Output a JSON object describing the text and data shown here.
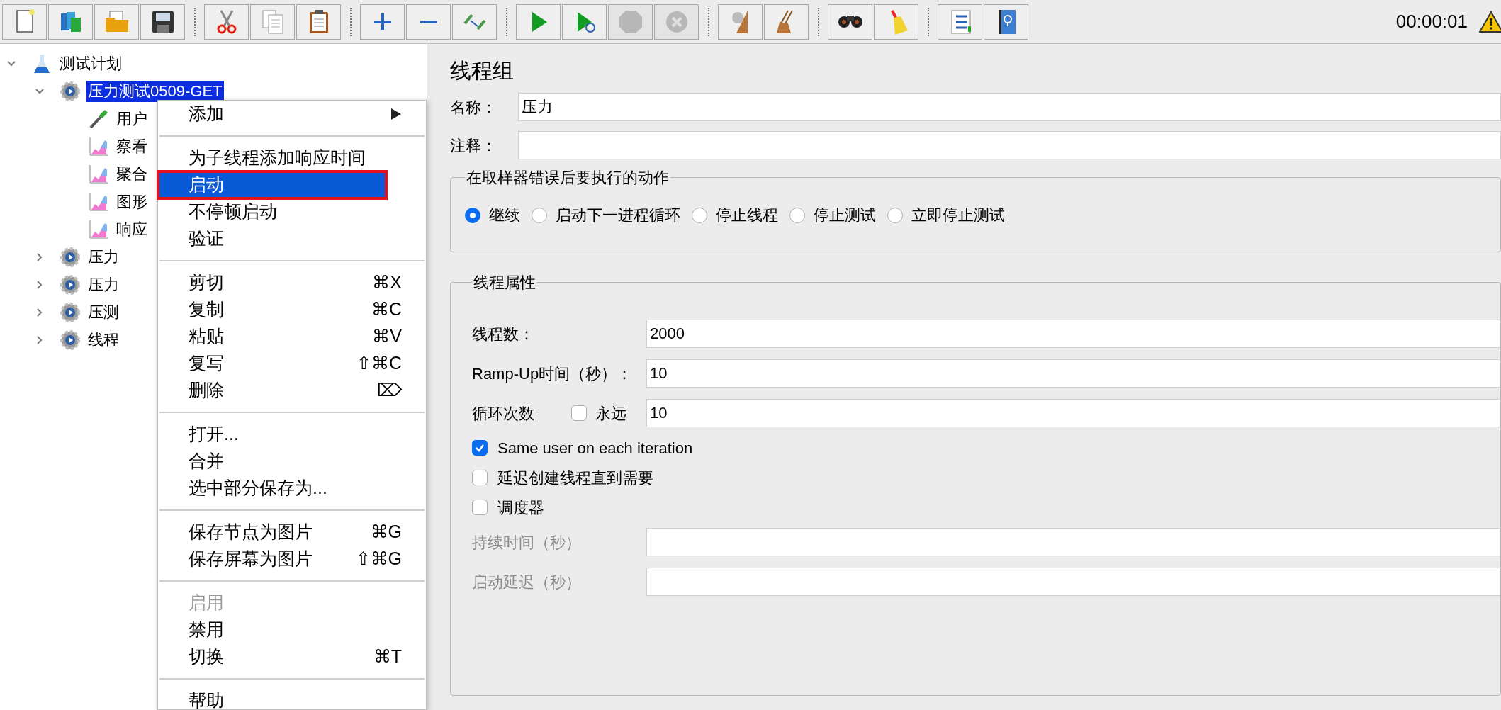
{
  "toolbar": {
    "groups": [
      [
        {
          "kind": "new",
          "disabled": false
        },
        {
          "kind": "templates",
          "disabled": false
        },
        {
          "kind": "open",
          "disabled": false
        },
        {
          "kind": "save",
          "disabled": false
        }
      ],
      [
        {
          "kind": "cut",
          "disabled": false
        },
        {
          "kind": "copy",
          "disabled": false
        },
        {
          "kind": "paste",
          "disabled": false
        }
      ],
      [
        {
          "kind": "expand",
          "disabled": false
        },
        {
          "kind": "collapse",
          "disabled": false
        },
        {
          "kind": "toggle",
          "disabled": false
        }
      ],
      [
        {
          "kind": "start",
          "disabled": false
        },
        {
          "kind": "start-no-pause",
          "disabled": false
        },
        {
          "kind": "stop",
          "disabled": true
        },
        {
          "kind": "shutdown",
          "disabled": true
        }
      ],
      [
        {
          "kind": "clear",
          "disabled": false
        },
        {
          "kind": "clear-all",
          "disabled": false
        }
      ],
      [
        {
          "kind": "search",
          "disabled": false
        },
        {
          "kind": "reset-search",
          "disabled": false
        }
      ],
      [
        {
          "kind": "function-helper",
          "disabled": false
        },
        {
          "kind": "help",
          "disabled": false
        }
      ]
    ],
    "timer": "00:00:01"
  },
  "tree": [
    {
      "label": "测试计划",
      "kind": "plan",
      "expanded": true,
      "selected": false,
      "children": [
        {
          "label": "压力测试0509-GET",
          "kind": "thread-group",
          "expanded": true,
          "selected": true,
          "children": [
            {
              "label": "用户",
              "kind": "sampler",
              "selected": false
            },
            {
              "label": "察看",
              "kind": "listener",
              "selected": false
            },
            {
              "label": "聚合",
              "kind": "listener",
              "selected": false
            },
            {
              "label": "图形",
              "kind": "listener",
              "selected": false
            },
            {
              "label": "响应",
              "kind": "listener",
              "selected": false
            }
          ]
        },
        {
          "label": "压力",
          "kind": "thread-group",
          "expanded": false,
          "selected": false
        },
        {
          "label": "压力",
          "kind": "thread-group",
          "expanded": false,
          "selected": false
        },
        {
          "label": "压测",
          "kind": "thread-group",
          "expanded": false,
          "selected": false
        },
        {
          "label": "线程",
          "kind": "thread-group",
          "expanded": false,
          "selected": false
        }
      ]
    }
  ],
  "context_menu": [
    {
      "kind": "submenu",
      "label": "添加",
      "selected": false,
      "disabled": false
    },
    {
      "kind": "separator"
    },
    {
      "kind": "item",
      "label": "为子线程添加响应时间",
      "selected": false,
      "disabled": false
    },
    {
      "kind": "item",
      "label": "启动",
      "selected": true,
      "disabled": false,
      "outlined": true
    },
    {
      "kind": "item",
      "label": "不停顿启动",
      "selected": false,
      "disabled": false
    },
    {
      "kind": "item",
      "label": "验证",
      "selected": false,
      "disabled": false
    },
    {
      "kind": "separator"
    },
    {
      "kind": "item",
      "label": "剪切",
      "shortcut": "⌘X",
      "selected": false,
      "disabled": false
    },
    {
      "kind": "item",
      "label": "复制",
      "shortcut": "⌘C",
      "selected": false,
      "disabled": false
    },
    {
      "kind": "item",
      "label": "粘贴",
      "shortcut": "⌘V",
      "selected": false,
      "disabled": false
    },
    {
      "kind": "item",
      "label": "复写",
      "shortcut": "⇧⌘C",
      "selected": false,
      "disabled": false
    },
    {
      "kind": "item",
      "label": "删除",
      "shortcut": "⌦",
      "selected": false,
      "disabled": false
    },
    {
      "kind": "separator"
    },
    {
      "kind": "item",
      "label": "打开...",
      "selected": false,
      "disabled": false
    },
    {
      "kind": "item",
      "label": "合并",
      "selected": false,
      "disabled": false
    },
    {
      "kind": "item",
      "label": "选中部分保存为...",
      "selected": false,
      "disabled": false
    },
    {
      "kind": "separator"
    },
    {
      "kind": "item",
      "label": "保存节点为图片",
      "shortcut": "⌘G",
      "selected": false,
      "disabled": false
    },
    {
      "kind": "item",
      "label": "保存屏幕为图片",
      "shortcut": "⇧⌘G",
      "selected": false,
      "disabled": false
    },
    {
      "kind": "separator"
    },
    {
      "kind": "item",
      "label": "启用",
      "selected": false,
      "disabled": true
    },
    {
      "kind": "item",
      "label": "禁用",
      "selected": false,
      "disabled": false
    },
    {
      "kind": "item",
      "label": "切换",
      "shortcut": "⌘T",
      "selected": false,
      "disabled": false
    },
    {
      "kind": "separator"
    },
    {
      "kind": "item",
      "label": "帮助",
      "selected": false,
      "disabled": false
    }
  ],
  "panel": {
    "title": "线程组",
    "name": {
      "label": "名称：",
      "value": "压力"
    },
    "comment": {
      "label": "注释："
    },
    "error_action": {
      "title": "在取样器错误后要执行的动作",
      "options": [
        {
          "label": "继续",
          "selected": true
        },
        {
          "label": "启动下一进程循环",
          "selected": false
        },
        {
          "label": "停止线程",
          "selected": false
        },
        {
          "label": "停止测试",
          "selected": false
        },
        {
          "label": "立即停止测试",
          "selected": false
        }
      ]
    },
    "thread_properties": {
      "title": "线程属性",
      "rows": [
        {
          "kind": "field",
          "label": "线程数：",
          "value": "2000",
          "disabled": false
        },
        {
          "kind": "field",
          "label": "Ramp-Up时间（秒）：",
          "value": "10",
          "disabled": false
        },
        {
          "kind": "loop",
          "label": "循环次数",
          "checkbox": {
            "label": "永远",
            "checked": false
          },
          "value": "10",
          "disabled": false
        },
        {
          "kind": "checkbox",
          "label": "Same user on each iteration",
          "checked": true
        },
        {
          "kind": "checkbox",
          "label": "延迟创建线程直到需要",
          "checked": false
        },
        {
          "kind": "checkbox",
          "label": "调度器",
          "checked": false
        },
        {
          "kind": "field",
          "label": "持续时间（秒）",
          "value": "",
          "disabled": true
        },
        {
          "kind": "field",
          "label": "启动延迟（秒）",
          "value": "",
          "disabled": true
        }
      ]
    }
  }
}
